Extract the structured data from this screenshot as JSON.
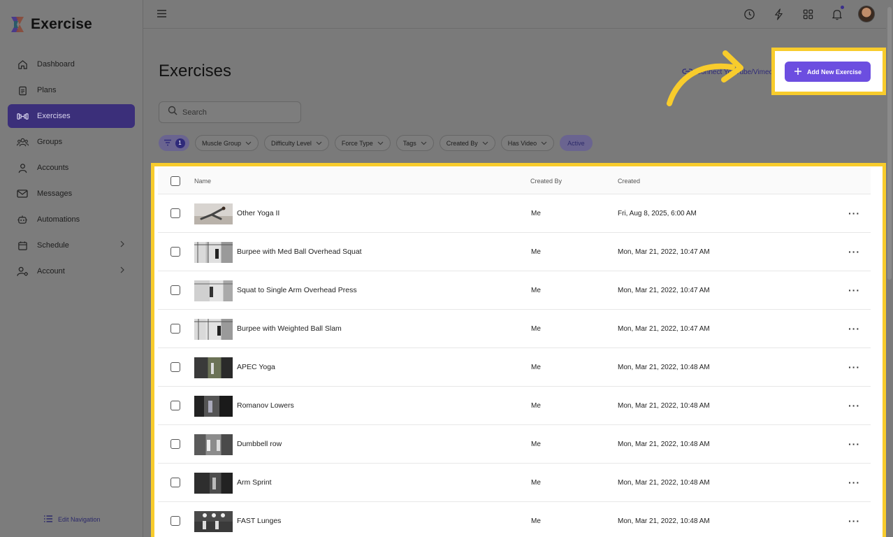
{
  "app": {
    "name": "Exercise"
  },
  "sidebar": {
    "items": [
      {
        "label": "Dashboard",
        "icon": "home-icon"
      },
      {
        "label": "Plans",
        "icon": "clipboard-icon"
      },
      {
        "label": "Exercises",
        "icon": "dumbbell-icon",
        "active": true
      },
      {
        "label": "Groups",
        "icon": "groups-icon"
      },
      {
        "label": "Accounts",
        "icon": "user-icon"
      },
      {
        "label": "Messages",
        "icon": "mail-icon"
      },
      {
        "label": "Automations",
        "icon": "robot-icon"
      },
      {
        "label": "Schedule",
        "icon": "calendar-icon",
        "has_children": true
      },
      {
        "label": "Account",
        "icon": "user-settings-icon",
        "has_children": true
      }
    ],
    "edit_nav_label": "Edit Navigation"
  },
  "topbar": {
    "icons": [
      "clock-icon",
      "lightning-icon",
      "grid-icon",
      "bell-icon",
      "avatar"
    ]
  },
  "main": {
    "title": "Exercises",
    "connect_label": "Connect YouTube/Vimeo",
    "add_button_label": "Add New Exercise",
    "search": {
      "placeholder": "Search",
      "value": ""
    },
    "filter_count": "1",
    "filters": [
      "Muscle Group",
      "Difficulty Level",
      "Force Type",
      "Tags",
      "Created By",
      "Has Video"
    ],
    "active_filter": "Active"
  },
  "table": {
    "columns": [
      "Name",
      "Created By",
      "Created"
    ],
    "rows": [
      {
        "name": "Other Yoga II",
        "created_by": "Me",
        "created": "Fri, Aug 8, 2025, 6:00 AM"
      },
      {
        "name": "Burpee with Med Ball Overhead Squat",
        "created_by": "Me",
        "created": "Mon, Mar 21, 2022, 10:47 AM"
      },
      {
        "name": "Squat to Single Arm Overhead Press",
        "created_by": "Me",
        "created": "Mon, Mar 21, 2022, 10:47 AM"
      },
      {
        "name": "Burpee with Weighted Ball Slam",
        "created_by": "Me",
        "created": "Mon, Mar 21, 2022, 10:47 AM"
      },
      {
        "name": "APEC Yoga",
        "created_by": "Me",
        "created": "Mon, Mar 21, 2022, 10:48 AM"
      },
      {
        "name": "Romanov Lowers",
        "created_by": "Me",
        "created": "Mon, Mar 21, 2022, 10:48 AM"
      },
      {
        "name": "Dumbbell row",
        "created_by": "Me",
        "created": "Mon, Mar 21, 2022, 10:48 AM"
      },
      {
        "name": "Arm Sprint",
        "created_by": "Me",
        "created": "Mon, Mar 21, 2022, 10:48 AM"
      },
      {
        "name": "FAST Lunges",
        "created_by": "Me",
        "created": "Mon, Mar 21, 2022, 10:48 AM"
      }
    ]
  },
  "colors": {
    "accent": "#6c4ee0",
    "highlight": "#f8cc2c",
    "active_nav": "#3b2f7a"
  }
}
